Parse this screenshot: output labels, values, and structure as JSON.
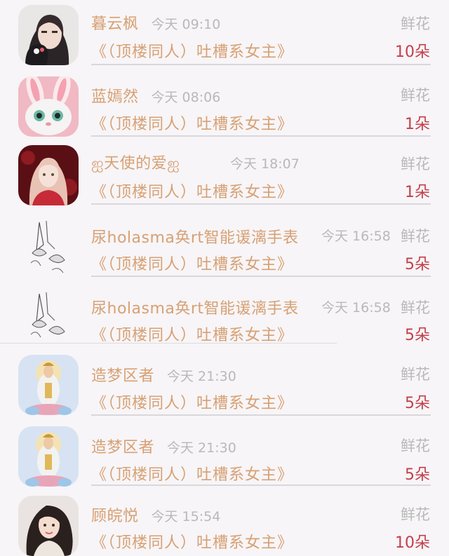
{
  "rows": [
    {
      "name": "暮云枫",
      "time": "今天 09:10",
      "gift": "鲜花",
      "title": "《（顶楼同人）吐槽系女主》",
      "count": "10朵",
      "avatar": "dark-hair-girl-avatar"
    },
    {
      "name": "蓝嫣然",
      "time": "今天 08:06",
      "gift": "鲜花",
      "title": "《（顶楼同人）吐槽系女主》",
      "count": "1朵",
      "avatar": "white-rabbit-avatar"
    },
    {
      "name": "天使的爱",
      "name_prefix": "ஐ",
      "name_suffix": "ஐ",
      "time": "今天 18:07",
      "gift": "鲜花",
      "title": "《（顶楼同人）吐槽系女主》",
      "count": "1朵",
      "avatar": "pink-hair-girl-avatar"
    },
    {
      "name": "尿holasma奂rt智能谖漓手表",
      "time": "今天 16:58",
      "gift": "鲜花",
      "title": "《（顶楼同人）吐槽系女主》",
      "count": "5朵",
      "avatar": "flower-sketch-avatar"
    },
    {
      "name": "尿holasma奂rt智能谖漓手表",
      "time": "今天 16:58",
      "gift": "鲜花",
      "title": "《（顶楼同人）吐槽系女主》",
      "count": "5朵",
      "avatar": "flower-sketch-avatar"
    },
    {
      "name": "造梦区者",
      "time": "今天 21:30",
      "gift": "鲜花",
      "title": "《（顶楼同人）吐槽系女主》",
      "count": "5朵",
      "avatar": "guanyin-avatar"
    },
    {
      "name": "造梦区者",
      "time": "今天 21:30",
      "gift": "鲜花",
      "title": "《（顶楼同人）吐槽系女主》",
      "count": "5朵",
      "avatar": "guanyin-avatar"
    },
    {
      "name": "顾皖悦",
      "time": "今天 15:54",
      "gift": "鲜花",
      "title": "《（顶楼同人）吐槽系女主》",
      "count": "10朵",
      "avatar": "brunette-girl-avatar"
    }
  ]
}
